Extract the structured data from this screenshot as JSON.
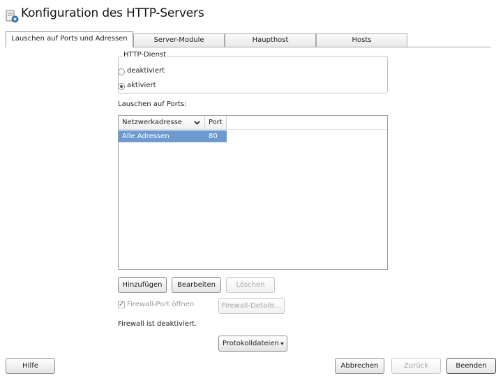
{
  "window": {
    "title": "Konfiguration des HTTP-Servers",
    "icon": "server-config-icon"
  },
  "tabs": [
    {
      "label": "Lauschen auf Ports und Adressen",
      "active": true
    },
    {
      "label": "Server-Module",
      "active": false
    },
    {
      "label": "Haupthost",
      "active": false
    },
    {
      "label": "Hosts",
      "active": false
    }
  ],
  "http_service": {
    "group_title": "HTTP-Dienst",
    "options": [
      {
        "label": "deaktiviert",
        "selected": false
      },
      {
        "label": "aktiviert",
        "selected": true
      }
    ]
  },
  "ports": {
    "label": "Lauschen auf Ports:",
    "columns": [
      "Netzwerkadresse",
      "Port"
    ],
    "sort_icon": "chevron-down-icon",
    "rows": [
      {
        "address": "Alle Adressen",
        "port": "80",
        "selected": true
      }
    ]
  },
  "row_buttons": {
    "add": "Hinzufügen",
    "edit": "Bearbeiten",
    "delete": "Löschen"
  },
  "firewall": {
    "checkbox_label": "Firewall-Port öffnen",
    "checked": true,
    "details_button": "Firewall-Details...",
    "status": "Firewall ist deaktiviert."
  },
  "log_files_button": "Protokolldateien",
  "footer": {
    "help": "Hilfe",
    "cancel": "Abbrechen",
    "back": "Zurück",
    "finish": "Beenden"
  },
  "colors": {
    "selection": "#6d9bcf",
    "disabled_text": "#a6a6a6"
  }
}
